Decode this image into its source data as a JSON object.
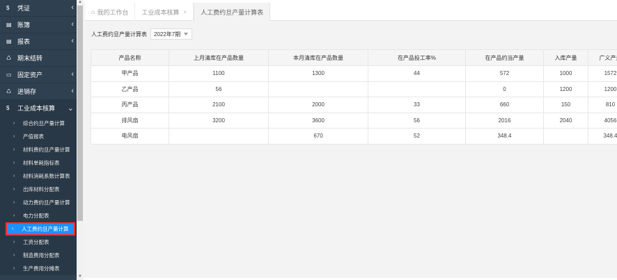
{
  "sidebar": {
    "items": [
      {
        "icon": "$",
        "label": "凭证"
      },
      {
        "icon": "▤",
        "label": "账簿"
      },
      {
        "icon": "▤",
        "label": "报表"
      },
      {
        "icon": "♺",
        "label": "期末结转"
      },
      {
        "icon": "▭",
        "label": "固定资产"
      },
      {
        "icon": "♺",
        "label": "进销存"
      },
      {
        "icon": "$",
        "label": "工业成本核算"
      }
    ],
    "sub_items": [
      "综合约旦产量计算",
      "产值报表",
      "材料费约旦产量计算",
      "材料单耗指标表",
      "材料消耗系数计算表",
      "出库材料分配表",
      "动力费约旦产量计算",
      "电力分配表",
      "人工费约旦产量计算",
      "工资分配表",
      "制造费用分配表",
      "生产费用分摊表"
    ],
    "active_sub_index": 8
  },
  "tabs": [
    {
      "label": "我的工作台",
      "icon": "home-icon"
    },
    {
      "label": "工业成本核算"
    },
    {
      "label": "人工费约旦产量计算表"
    }
  ],
  "toolbar": {
    "label": "人工费约旦产量计算表",
    "period": "2022年7期"
  },
  "table": {
    "headers": [
      "产品名称",
      "上月清库在产品数量",
      "本月清库在产品数量",
      "在产品投工率%",
      "在产品约当产量",
      "入库产量",
      "广义产量"
    ],
    "rows": [
      [
        "甲产品",
        "1100",
        "1300",
        "44",
        "572",
        "1000",
        "1572"
      ],
      [
        "乙产品",
        "56",
        "",
        "",
        "0",
        "1200",
        "1200"
      ],
      [
        "丙产品",
        "2100",
        "2000",
        "33",
        "660",
        "150",
        "810"
      ],
      [
        "排风扇",
        "3200",
        "3600",
        "56",
        "2016",
        "2040",
        "4056"
      ],
      [
        "电风扇",
        "",
        "670",
        "52",
        "348.4",
        "",
        "348.4"
      ]
    ]
  },
  "colors": {
    "sidebar_bg": "#2f4050",
    "active_item": "#1e90ff",
    "highlight_border": "#ff2b2b"
  }
}
